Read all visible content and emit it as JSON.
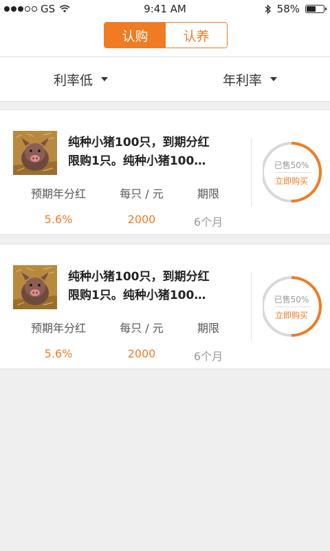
{
  "status_bar": {
    "carrier": "GS",
    "time": "9:41 AM",
    "battery": "58%",
    "battery_level": 0.58
  },
  "segmented_control": {
    "tabs": [
      {
        "label": "认购",
        "active": true
      },
      {
        "label": "认养",
        "active": false
      }
    ]
  },
  "filters": [
    {
      "label": "利率低"
    },
    {
      "label": "年利率"
    }
  ],
  "stat_labels": {
    "dividend": "预期年分红",
    "price": "每只 / 元",
    "term": "期限"
  },
  "products": [
    {
      "title_line1": "纯种小猪100只，到期分红",
      "title_line2": "限购1只。纯种小猪100…",
      "dividend": "5.6%",
      "price": "2000",
      "term": "6个月",
      "sold_text": "已售50%",
      "sold_fraction": 0.5,
      "buy_label": "立即购买",
      "image_icon": "pig-photo"
    },
    {
      "title_line1": "纯种小猪100只，到期分红",
      "title_line2": "限购1只。纯种小猪100…",
      "dividend": "5.6%",
      "price": "2000",
      "term": "6个月",
      "sold_text": "已售50%",
      "sold_fraction": 0.5,
      "buy_label": "立即购买",
      "image_icon": "pig-photo"
    }
  ],
  "colors": {
    "accent": "#f07b22",
    "ring_track": "#d9d9d9"
  }
}
